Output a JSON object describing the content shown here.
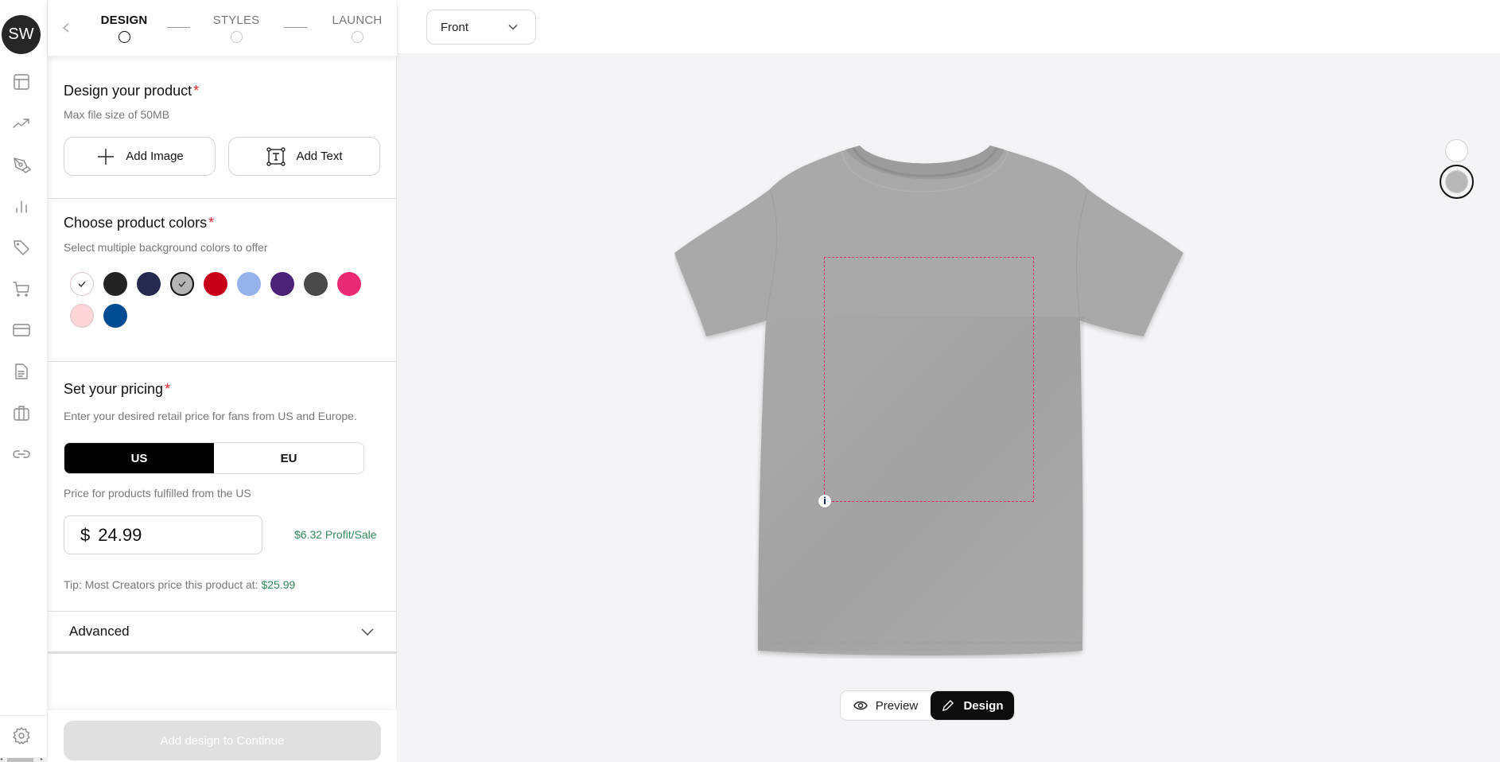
{
  "user": {
    "initials": "SW"
  },
  "sidebar": {
    "items": [
      {
        "name": "dashboard",
        "icon": "layout-icon"
      },
      {
        "name": "analytics",
        "icon": "trending-up-icon"
      },
      {
        "name": "design",
        "icon": "pen-tool-icon"
      },
      {
        "name": "stats",
        "icon": "bar-chart-icon"
      },
      {
        "name": "tags",
        "icon": "tag-icon"
      },
      {
        "name": "orders",
        "icon": "cart-icon"
      },
      {
        "name": "payments",
        "icon": "credit-card-icon"
      },
      {
        "name": "documents",
        "icon": "document-icon"
      },
      {
        "name": "business",
        "icon": "briefcase-icon"
      },
      {
        "name": "links",
        "icon": "link-icon"
      }
    ],
    "settings_icon": "gear-icon"
  },
  "stepper": {
    "steps": [
      {
        "label": "DESIGN",
        "active": true
      },
      {
        "label": "STYLES",
        "active": false
      },
      {
        "label": "LAUNCH",
        "active": false
      }
    ]
  },
  "design_section": {
    "title": "Design your product",
    "required_mark": "*",
    "subtitle": "Max file size of 50MB",
    "add_image_label": "Add Image",
    "add_text_label": "Add Text"
  },
  "colors_section": {
    "title": "Choose product colors",
    "required_mark": "*",
    "subtitle": "Select multiple background colors to offer",
    "swatches": [
      {
        "color": "#ffffff",
        "selected": true
      },
      {
        "color": "#232323",
        "selected": false
      },
      {
        "color": "#252a4e",
        "selected": false
      },
      {
        "color": "#b4b4b4",
        "selected": true
      },
      {
        "color": "#c8001a",
        "selected": false
      },
      {
        "color": "#95b2ec",
        "selected": false
      },
      {
        "color": "#4c2278",
        "selected": false
      },
      {
        "color": "#4a4a4a",
        "selected": false
      },
      {
        "color": "#ea2b72",
        "selected": false
      },
      {
        "color": "#ffd5d8",
        "selected": false
      },
      {
        "color": "#034b92",
        "selected": false
      }
    ]
  },
  "pricing_section": {
    "title": "Set your pricing",
    "required_mark": "*",
    "subtitle": "Enter your desired retail price for fans from US and Europe.",
    "regions": [
      "US",
      "EU"
    ],
    "selected_region": "US",
    "fulfilled_label": "Price for products fulfilled from the US",
    "currency_symbol": "$",
    "price_value": "24.99",
    "profit_label": "$6.32 Profit/Sale",
    "tip_text": "Tip: Most Creators price this product at: ",
    "tip_price": "$25.99"
  },
  "advanced": {
    "label": "Advanced"
  },
  "footer": {
    "continue_label": "Add design to Continue"
  },
  "canvas": {
    "view_select": {
      "value": "Front"
    },
    "product_color": "#a9a9a9",
    "print_area_color": "#dc2a5a",
    "info_icon_glyph": "i",
    "mode_toggle": {
      "preview_label": "Preview",
      "design_label": "Design",
      "active": "Design"
    },
    "side_colors": [
      {
        "color": "#ffffff",
        "selected": false
      },
      {
        "color": "#b8b8b8",
        "selected": true
      }
    ]
  }
}
